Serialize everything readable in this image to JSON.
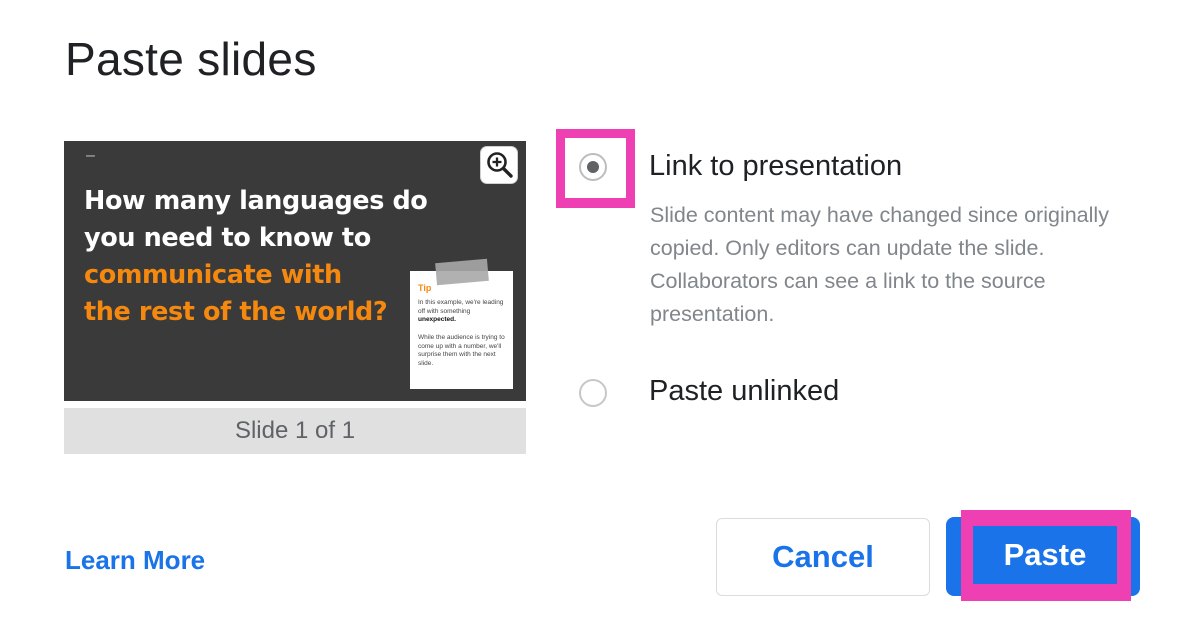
{
  "dialog": {
    "title": "Paste slides"
  },
  "preview": {
    "dash": "–",
    "headline_line1": "How many languages do",
    "headline_line2": "you need to know to",
    "headline_accent1": "communicate with",
    "headline_accent2": "the rest of the world?",
    "note_tip": "Tip",
    "note_p1_a": "In this example, we're leading off with something ",
    "note_p1_bold": "unexpected.",
    "note_p2": "While the audience is trying to come up with a number, we'll surprise them with the next slide.",
    "caption": "Slide 1 of 1",
    "zoom_icon": "zoom-in-icon"
  },
  "options": {
    "linked": {
      "label": "Link to presentation",
      "description": "Slide content may have changed since originally copied. Only editors can update the slide. Collaborators can see a link to the source presentation.",
      "selected": true
    },
    "unlinked": {
      "label": "Paste unlinked",
      "selected": false
    }
  },
  "footer": {
    "learn_more": "Learn More",
    "cancel_label": "Cancel",
    "paste_label": "Paste"
  },
  "colors": {
    "accent_blue": "#1a73e8",
    "highlight_pink": "#ee3fb3",
    "slide_orange": "#f5890f"
  }
}
